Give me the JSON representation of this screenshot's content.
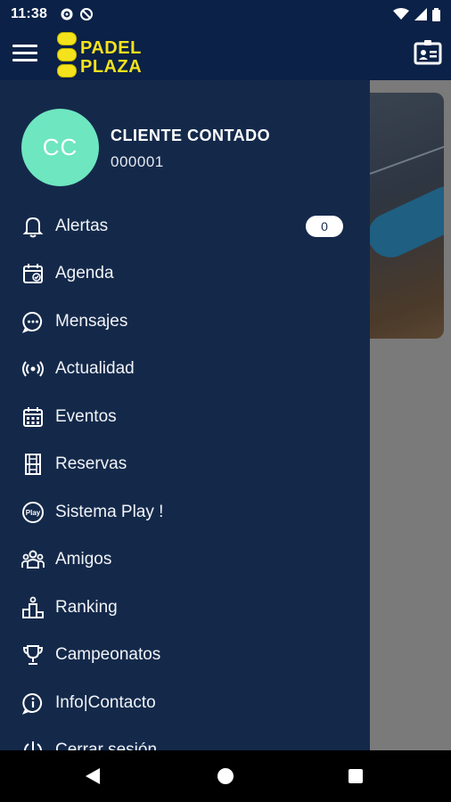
{
  "status_bar": {
    "time": "11:38"
  },
  "app": {
    "logo_line1": "PADEL",
    "logo_line2": "PLAZA",
    "accent": "#f3e21c"
  },
  "user": {
    "initials": "CC",
    "name": "CLIENTE CONTADO",
    "code": "000001"
  },
  "menu": [
    {
      "label": "Alertas",
      "icon": "bell-icon",
      "badge": "0"
    },
    {
      "label": "Agenda",
      "icon": "calendar-check-icon"
    },
    {
      "label": "Mensajes",
      "icon": "chat-bubble-icon"
    },
    {
      "label": "Actualidad",
      "icon": "broadcast-icon"
    },
    {
      "label": "Eventos",
      "icon": "calendar-grid-icon"
    },
    {
      "label": "Reservas",
      "icon": "court-icon"
    },
    {
      "label": "Sistema Play !",
      "icon": "play-badge-icon"
    },
    {
      "label": "Amigos",
      "icon": "group-icon"
    },
    {
      "label": "Ranking",
      "icon": "podium-icon"
    },
    {
      "label": "Campeonatos",
      "icon": "trophy-icon"
    },
    {
      "label": "Info|Contacto",
      "icon": "info-bubble-icon"
    },
    {
      "label": "Cerrar sesión",
      "icon": "power-icon"
    }
  ]
}
